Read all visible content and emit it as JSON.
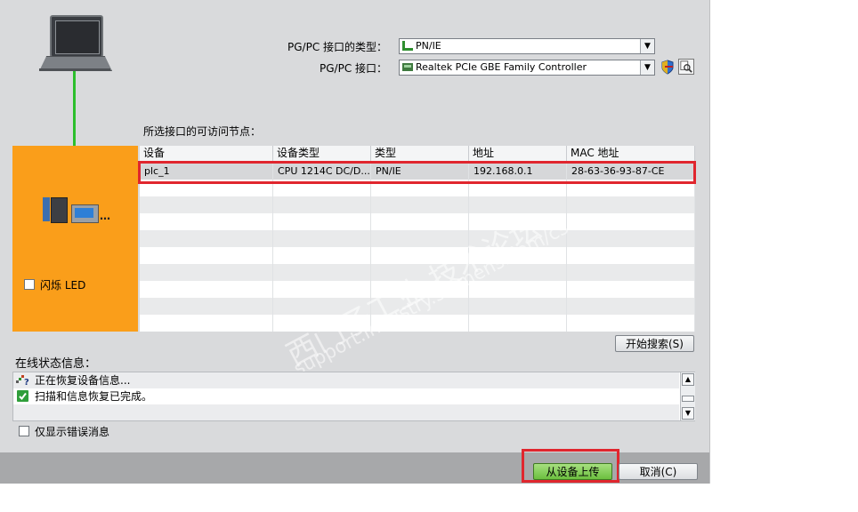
{
  "interface": {
    "type_label": "PG/PC 接口的类型：",
    "type_value": "PN/IE",
    "interface_label": "PG/PC 接口：",
    "interface_value": "Realtek PCIe GBE Family Controller"
  },
  "nodes": {
    "label": "所选接口的可访问节点：",
    "columns": [
      "设备",
      "设备类型",
      "类型",
      "地址",
      "MAC 地址"
    ],
    "rows": [
      [
        "plc_1",
        "CPU 1214C DC/D...",
        "PN/IE",
        "192.168.0.1",
        "28-63-36-93-87-CE"
      ]
    ]
  },
  "led": {
    "label": "闪烁 LED",
    "checked": false
  },
  "search_button": "开始搜索(S)",
  "online_status": {
    "label": "在线状态信息：",
    "messages": [
      {
        "icon": "search-progress-icon",
        "text": "正在恢复设备信息..."
      },
      {
        "icon": "checkmark-icon",
        "text": "扫描和信息恢复已完成。"
      }
    ]
  },
  "errors_only": {
    "label": "仅显示错误消息",
    "checked": false
  },
  "footer": {
    "upload_button": "从设备上传",
    "cancel_button": "取消(C)"
  },
  "watermark": {
    "line1": "西门子工业 技术论坛",
    "line2": "support.industry.siemens.com/cs"
  },
  "colors": {
    "dialog_bg": "#d9dadc",
    "device_panel": "#fa9e1a",
    "highlight": "#e0262e",
    "connection_line": "#2cbf2c"
  }
}
